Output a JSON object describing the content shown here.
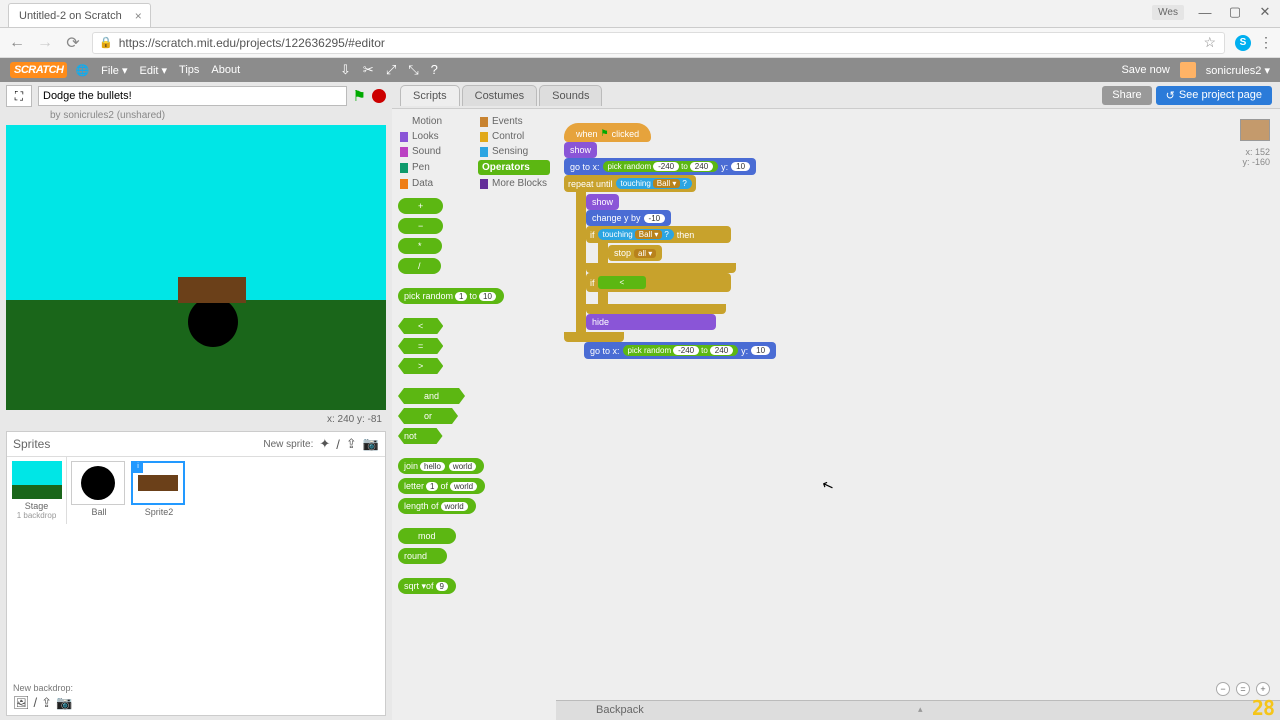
{
  "browser": {
    "tab_title": "Untitled-2 on Scratch",
    "url": "https://scratch.mit.edu/projects/122636295/#editor",
    "user_label": "Wes"
  },
  "topbar": {
    "file": "File ▾",
    "edit": "Edit ▾",
    "tips": "Tips",
    "about": "About",
    "save": "Save now",
    "username": "sonicrules2 ▾"
  },
  "project": {
    "title": "Dodge the bullets!",
    "byline": "by sonicrules2 (unshared)",
    "stage_coords": "x: 240   y: -81"
  },
  "sprite_panel": {
    "title": "Sprites",
    "new_label": "New sprite:",
    "stage_label": "Stage",
    "backdrop_count": "1 backdrop",
    "new_backdrop": "New backdrop:",
    "sprites": [
      {
        "name": "Ball"
      },
      {
        "name": "Sprite2"
      }
    ]
  },
  "tabs": {
    "scripts": "Scripts",
    "costumes": "Costumes",
    "sounds": "Sounds"
  },
  "buttons": {
    "share": "Share",
    "see": "See project page"
  },
  "categories": {
    "motion": "Motion",
    "looks": "Looks",
    "sound": "Sound",
    "pen": "Pen",
    "data": "Data",
    "events": "Events",
    "control": "Control",
    "sensing": "Sensing",
    "operators": "Operators",
    "more": "More Blocks"
  },
  "cat_colors": {
    "motion": "#4a6cd4",
    "looks": "#8a55d7",
    "sound": "#bb42c3",
    "pen": "#0e9a6c",
    "data": "#ee7d16",
    "events": "#c88330",
    "control": "#e1a91a",
    "sensing": "#2ca5e2",
    "operators": "#5cb712",
    "more": "#632d99"
  },
  "operator_blocks": {
    "pick_random": "pick random",
    "to": "to",
    "and": "and",
    "or": "or",
    "not": "not",
    "join": "join",
    "letter": "letter",
    "of": "of",
    "length_of": "length of",
    "mod": "mod",
    "round": "round",
    "sqrt": "sqrt ▾",
    "v1": "1",
    "v10": "10",
    "hello": "hello",
    "world": "world",
    "v9": "9"
  },
  "script": {
    "when_clicked_a": "when",
    "when_clicked_b": "clicked",
    "show": "show",
    "go_to_x": "go to x:",
    "pick_random": "pick random",
    "neg240": "-240",
    "to": "to",
    "pos240": "240",
    "y": "y:",
    "y10": "10",
    "repeat_until": "repeat until",
    "touching": "touching",
    "ball": "Ball ▾",
    "qm": "?",
    "change_y": "change y by",
    "neg10": "-10",
    "if": "if",
    "then": "then",
    "stop": "stop",
    "all": "all ▾",
    "hide": "hide"
  },
  "canvas_coords": {
    "x": "x: 152",
    "y": "y: -160"
  },
  "backpack": "Backpack",
  "yt_num": "28"
}
